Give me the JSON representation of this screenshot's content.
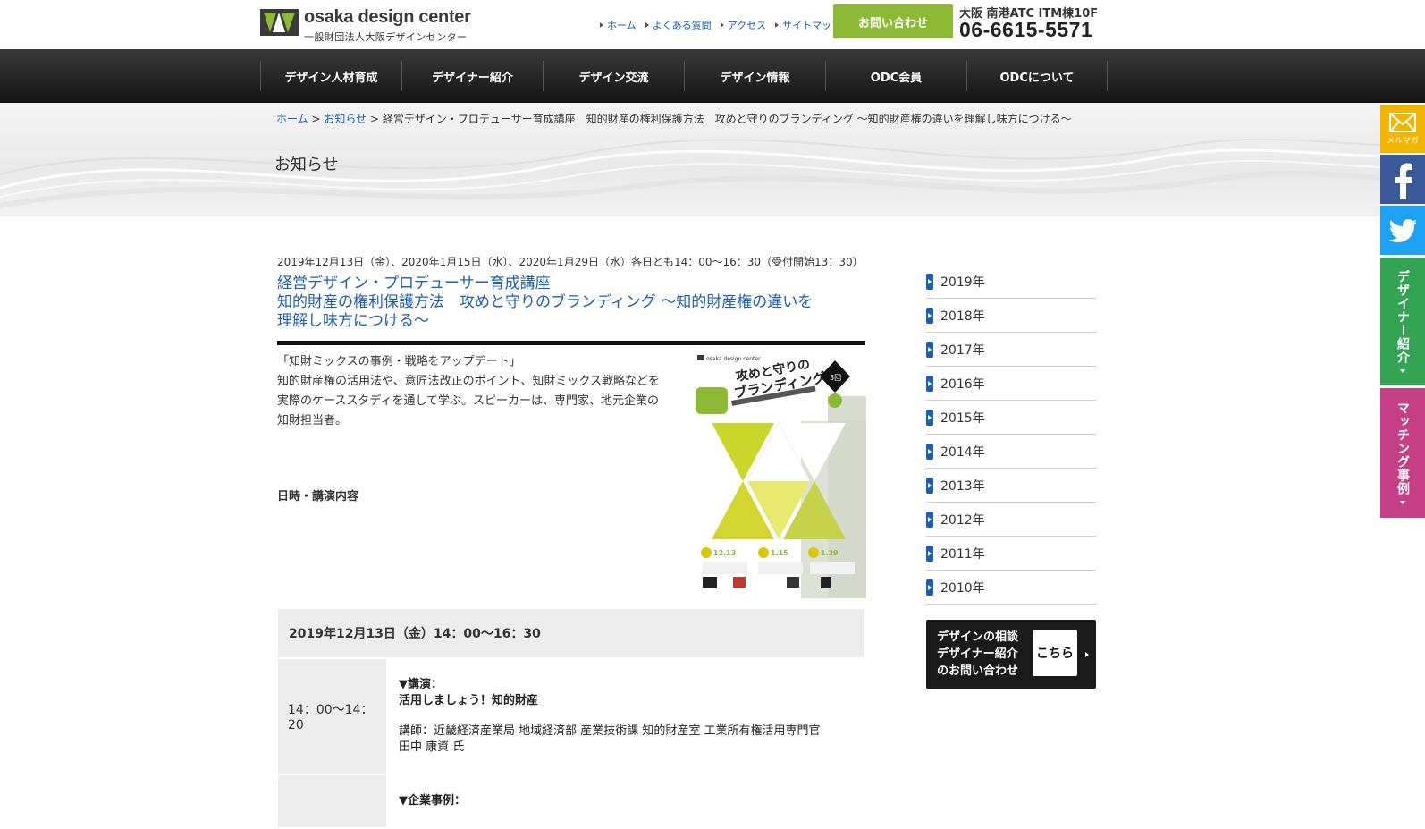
{
  "header": {
    "logo_name": "osaka design center",
    "logo_sub": "一般財団法人大阪デザインセンター",
    "util_links": [
      "ホーム",
      "よくある質問",
      "アクセス",
      "サイトマップ"
    ],
    "contact_label": "お問い合わせ",
    "address": "大阪 南港ATC ITM棟10F",
    "phone": "06-6615-5571"
  },
  "nav": {
    "items": [
      "デザイン人材育成",
      "デザイナー紹介",
      "デザイン交流",
      "デザイン情報",
      "ODC会員",
      "ODCについて"
    ]
  },
  "breadcrumb": {
    "home": "ホーム",
    "sep": ">",
    "news": "お知らせ",
    "current": "経営デザイン・プロデューサー育成講座　知的財産の権利保護方法　攻めと守りのブランディング 〜知的財産権の違いを理解し味方につける〜"
  },
  "page_heading": "お知らせ",
  "article": {
    "date": "2019年12月13日（金）、2020年1月15日（水）、2020年1月29日（水）各日とも14：00〜16：30（受付開始13：30）",
    "title_line1": "経営デザイン・プロデューサー育成講座",
    "title_line2": "知的財産の権利保護方法　攻めと守りのブランディング 〜知的財産権の違いを",
    "title_line3": "理解し味方につける〜",
    "intro_line1": "「知財ミックスの事例・戦略をアップデート」",
    "intro_line2": "知的財産権の活用法や、意匠法改正のポイント、知財ミックス戦略などを実際のケーススタディを通して学ぶ。スピーカーは、専門家、地元企業の知財担当者。",
    "schedule_heading": "日時・講演内容"
  },
  "poster": {
    "logo_text": "osaka design center",
    "title_line1": "攻めと守りの",
    "title_line2": "ブランディング",
    "badge": "3回",
    "dates": [
      "12.13",
      "1.15",
      "1.29"
    ]
  },
  "schedule": {
    "session_title": "2019年12月13日（金）14：00〜16：30",
    "rows": [
      {
        "time": "14：00〜14：20",
        "type": "▼講演：",
        "title": "活用しましょう！知的財産",
        "speaker_line1": "講師：近畿経済産業局 地域経済部 産業技術課 知的財産室 工業所有権活用専門官",
        "speaker_line2": "田中 康資 氏"
      },
      {
        "time": "",
        "type": "▼企業事例："
      }
    ]
  },
  "sidebar": {
    "years": [
      "2019年",
      "2018年",
      "2017年",
      "2016年",
      "2015年",
      "2014年",
      "2013年",
      "2012年",
      "2011年",
      "2010年"
    ],
    "consult_lines": [
      "デザインの相談",
      "デザイナー紹介",
      "のお問い合わせ"
    ],
    "consult_button": "こちら"
  },
  "side_tabs": {
    "mail_label": "メルマガ",
    "designer_label": "デザイナー紹介",
    "matching_label": "マッチング事例"
  },
  "colors": {
    "accent_green": "#8dba34",
    "link_blue": "#1a5fb4",
    "mail_tab": "#f2b500",
    "facebook": "#3b5998",
    "twitter": "#1da1f2",
    "designer_tab": "#33a354",
    "matching_tab": "#c53f87"
  }
}
